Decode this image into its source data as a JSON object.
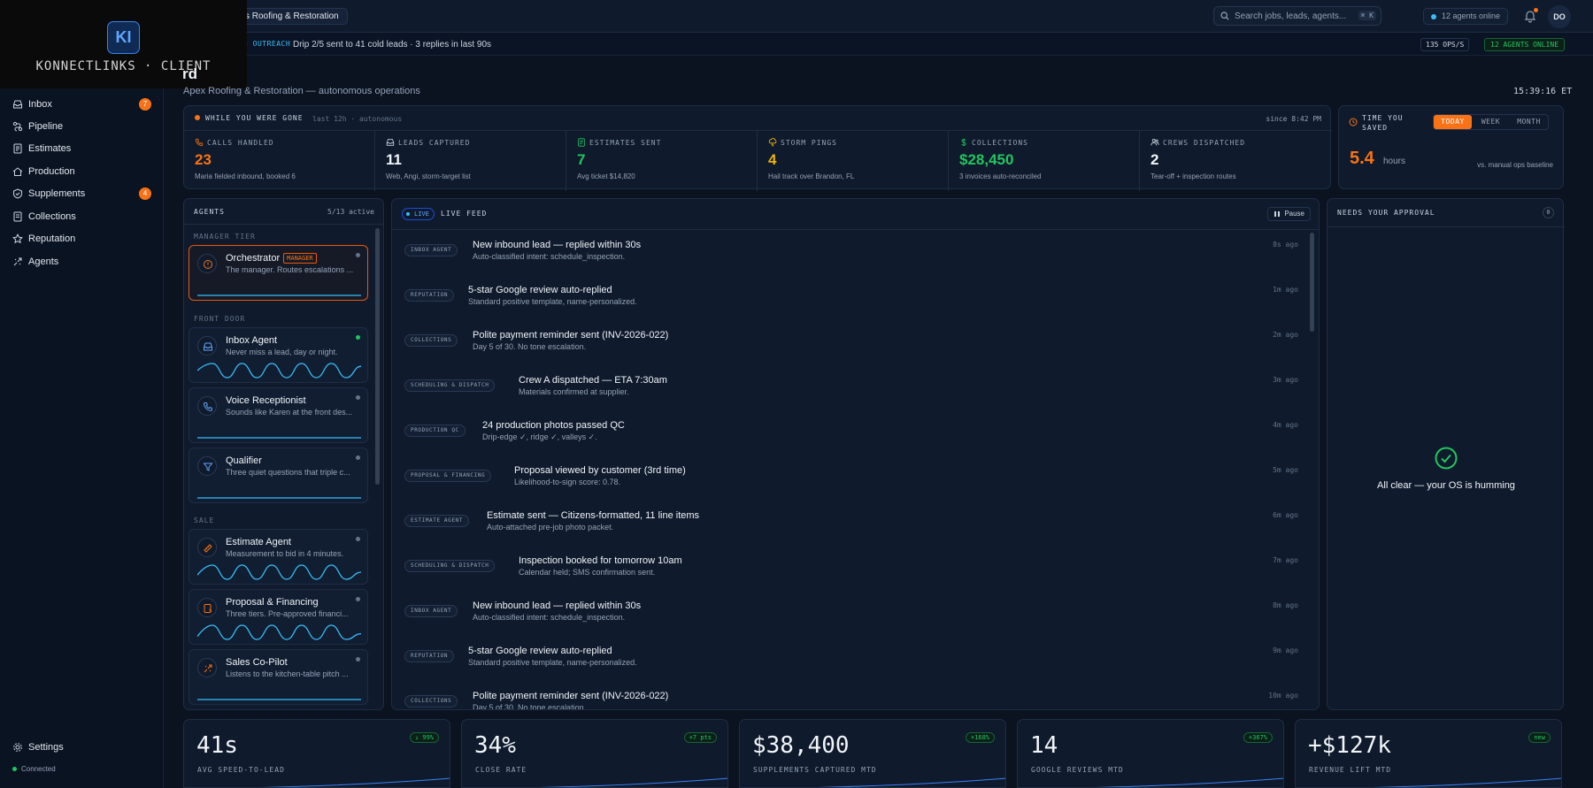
{
  "brand": {
    "logo_text": "KI",
    "name": "KONNECTLINKS · CLIENT"
  },
  "topbar": {
    "workspace": "s Roofing & Restoration",
    "search_placeholder": "Search jobs, leads, agents...",
    "search_shortcut": "⌘ K",
    "online_status": "12 agents online",
    "avatar_initials": "DO"
  },
  "ticker": {
    "tag": "3 OUTREACH",
    "message": "Drip 2/5 sent to 41 cold leads · 3 replies in last 90s",
    "ops": "135 OPS/S",
    "agents_online": "12 AGENTS ONLINE"
  },
  "sidebar": {
    "items": [
      {
        "label": "Inbox",
        "icon": "inbox-icon",
        "badge": "7"
      },
      {
        "label": "Pipeline",
        "icon": "pipeline-icon",
        "badge": ""
      },
      {
        "label": "Estimates",
        "icon": "estimates-icon",
        "badge": ""
      },
      {
        "label": "Production",
        "icon": "production-icon",
        "badge": ""
      },
      {
        "label": "Supplements",
        "icon": "supplements-icon",
        "badge": "4"
      },
      {
        "label": "Collections",
        "icon": "collections-icon",
        "badge": ""
      },
      {
        "label": "Reputation",
        "icon": "star-icon",
        "badge": ""
      },
      {
        "label": "Agents",
        "icon": "agents-icon",
        "badge": ""
      }
    ],
    "settings": "Settings",
    "status": "Connected"
  },
  "page": {
    "title": "rd",
    "subtitle": "Apex Roofing & Restoration — autonomous operations",
    "clock": "15:39:16 ET"
  },
  "while_gone": {
    "title": "WHILE YOU WERE GONE",
    "meta": "last 12h · autonomous",
    "since": "since 8:42 PM",
    "stats": [
      {
        "label": "CALLS HANDLED",
        "value": "23",
        "sub": "Maria fielded inbound, booked 6",
        "color": "#f97316",
        "icon": "phone-icon"
      },
      {
        "label": "LEADS CAPTURED",
        "value": "11",
        "sub": "Web, Angi, storm-target list",
        "color": "#f1f5f9",
        "icon": "inbox-icon"
      },
      {
        "label": "ESTIMATES SENT",
        "value": "7",
        "sub": "Avg ticket $14,820",
        "color": "#22c55e",
        "icon": "document-icon"
      },
      {
        "label": "STORM PINGS",
        "value": "4",
        "sub": "Hail track over Brandon, FL",
        "color": "#eab308",
        "icon": "storm-icon"
      },
      {
        "label": "COLLECTIONS",
        "value": "$28,450",
        "sub": "3 invoices auto-reconciled",
        "color": "#22c55e",
        "icon": "dollar-icon"
      },
      {
        "label": "CREWS DISPATCHED",
        "value": "2",
        "sub": "Tear-off + inspection routes",
        "color": "#f1f5f9",
        "icon": "crew-icon"
      }
    ]
  },
  "time_saved": {
    "label": "TIME YOU SAVED",
    "tabs": [
      "TODAY",
      "WEEK",
      "MONTH"
    ],
    "active_tab": "TODAY",
    "value": "5.4",
    "unit": "hours",
    "baseline": "vs. manual ops baseline"
  },
  "agents": {
    "title": "AGENTS",
    "count": "5/13 active",
    "tiers": [
      "MANAGER TIER",
      "FRONT DOOR",
      "SALE"
    ],
    "cards": [
      {
        "name": "Orchestrator",
        "tag": "MANAGER",
        "desc": "The manager. Routes escalations ...",
        "icon": "orchestrator-icon",
        "active": false,
        "activity": [
          0,
          0,
          0,
          0,
          0,
          0,
          0,
          0,
          0,
          0,
          0,
          0
        ]
      },
      {
        "name": "Inbox Agent",
        "tag": "",
        "desc": "Never miss a lead, day or night.",
        "icon": "inbox-icon",
        "active": true,
        "activity": [
          0.5,
          1,
          0,
          1,
          0,
          1,
          0,
          1,
          0,
          1,
          0,
          0.8
        ]
      },
      {
        "name": "Voice Receptionist",
        "tag": "",
        "desc": "Sounds like Karen at the front des...",
        "icon": "phone-icon",
        "active": false,
        "activity": [
          0,
          0,
          0,
          0,
          0,
          0,
          0,
          0,
          0,
          0,
          0,
          0
        ]
      },
      {
        "name": "Qualifier",
        "tag": "",
        "desc": "Three quiet questions that triple c...",
        "icon": "filter-icon",
        "active": false,
        "activity": [
          0,
          0,
          0,
          0,
          0,
          0,
          0,
          0,
          0,
          0,
          0,
          0
        ]
      },
      {
        "name": "Estimate Agent",
        "tag": "",
        "desc": "Measurement to bid in 4 minutes.",
        "icon": "ruler-icon",
        "active": false,
        "activity": [
          0.3,
          1,
          0,
          1,
          0,
          1,
          0,
          1,
          0,
          1,
          0,
          0.5
        ]
      },
      {
        "name": "Proposal & Financing",
        "tag": "",
        "desc": "Three tiers. Pre-approved financi...",
        "icon": "proposal-icon",
        "active": false,
        "activity": [
          0.2,
          1,
          0,
          1,
          0,
          1,
          0,
          1,
          0,
          1,
          0,
          0.4
        ]
      },
      {
        "name": "Sales Co-Pilot",
        "tag": "",
        "desc": "Listens to the kitchen-table pitch ...",
        "icon": "copilot-icon",
        "active": false,
        "activity": [
          0,
          0,
          0,
          0,
          0,
          0,
          0,
          0,
          0,
          0,
          0,
          0
        ]
      }
    ]
  },
  "feed": {
    "live": "LIVE",
    "title": "LIVE FEED",
    "pause": "Pause",
    "items": [
      {
        "tag": "INBOX AGENT",
        "title": "New inbound lead — replied within 30s",
        "sub": "Auto-classified intent: schedule_inspection.",
        "ago": "8s ago"
      },
      {
        "tag": "REPUTATION",
        "title": "5-star Google review auto-replied",
        "sub": "Standard positive template, name-personalized.",
        "ago": "1m ago"
      },
      {
        "tag": "COLLECTIONS",
        "title": "Polite payment reminder sent (INV-2026-022)",
        "sub": "Day 5 of 30. No tone escalation.",
        "ago": "2m ago"
      },
      {
        "tag": "SCHEDULING & DISPATCH",
        "title": "Crew A dispatched — ETA 7:30am",
        "sub": "Materials confirmed at supplier.",
        "ago": "3m ago"
      },
      {
        "tag": "PRODUCTION QC",
        "title": "24 production photos passed QC",
        "sub": "Drip-edge ✓, ridge ✓, valleys ✓.",
        "ago": "4m ago"
      },
      {
        "tag": "PROPOSAL & FINANCING",
        "title": "Proposal viewed by customer (3rd time)",
        "sub": "Likelihood-to-sign score: 0.78.",
        "ago": "5m ago"
      },
      {
        "tag": "ESTIMATE AGENT",
        "title": "Estimate sent — Citizens-formatted, 11 line items",
        "sub": "Auto-attached pre-job photo packet.",
        "ago": "6m ago"
      },
      {
        "tag": "SCHEDULING & DISPATCH",
        "title": "Inspection booked for tomorrow 10am",
        "sub": "Calendar held; SMS confirmation sent.",
        "ago": "7m ago"
      },
      {
        "tag": "INBOX AGENT",
        "title": "New inbound lead — replied within 30s",
        "sub": "Auto-classified intent: schedule_inspection.",
        "ago": "8m ago"
      },
      {
        "tag": "REPUTATION",
        "title": "5-star Google review auto-replied",
        "sub": "Standard positive template, name-personalized.",
        "ago": "9m ago"
      },
      {
        "tag": "COLLECTIONS",
        "title": "Polite payment reminder sent (INV-2026-022)",
        "sub": "Day 5 of 30. No tone escalation.",
        "ago": "10m ago"
      }
    ]
  },
  "approval": {
    "title": "NEEDS YOUR APPROVAL",
    "count": "0",
    "message": "All clear — your OS is humming"
  },
  "kpis": [
    {
      "value": "41s",
      "label": "AVG SPEED-TO-LEAD",
      "delta": "↓ 99%"
    },
    {
      "value": "34%",
      "label": "CLOSE RATE",
      "delta": "+7 pts"
    },
    {
      "value": "$38,400",
      "label": "SUPPLEMENTS CAPTURED MTD",
      "delta": "+168%"
    },
    {
      "value": "14",
      "label": "GOOGLE REVIEWS MTD",
      "delta": "+367%"
    },
    {
      "value": "+$127k",
      "label": "REVENUE LIFT MTD",
      "delta": "new"
    }
  ],
  "colors": {
    "accent": "#f97316",
    "positive": "#22c55e",
    "info": "#38bdf8",
    "bg": "#0b1220"
  }
}
